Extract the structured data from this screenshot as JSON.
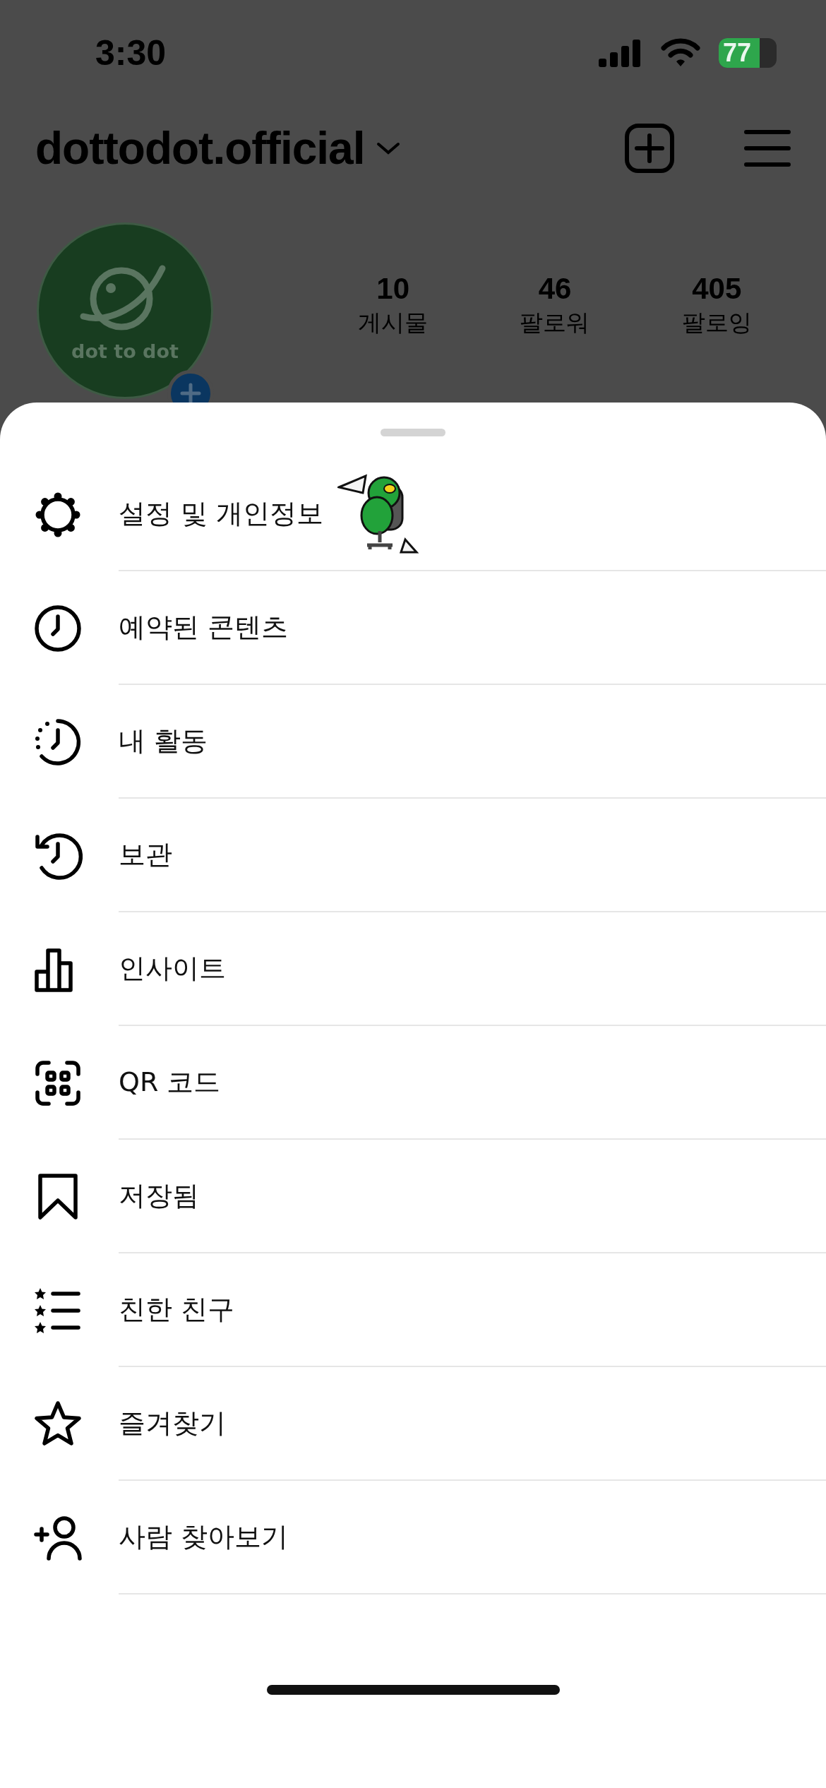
{
  "status_bar": {
    "time": "3:30",
    "battery": "77"
  },
  "header": {
    "username": "dottodot.official"
  },
  "profile": {
    "logo_text": "dot to dot",
    "stats": [
      {
        "value": "10",
        "label": "게시물"
      },
      {
        "value": "46",
        "label": "팔로워"
      },
      {
        "value": "405",
        "label": "팔로잉"
      }
    ]
  },
  "menu": [
    {
      "label": "설정 및 개인정보",
      "sticker": true
    },
    {
      "label": "예약된 콘텐츠"
    },
    {
      "label": "내 활동"
    },
    {
      "label": "보관"
    },
    {
      "label": "인사이트"
    },
    {
      "label": "QR 코드"
    },
    {
      "label": "저장됨"
    },
    {
      "label": "친한 친구"
    },
    {
      "label": "즐겨찾기"
    },
    {
      "label": "사람 찾아보기"
    }
  ]
}
